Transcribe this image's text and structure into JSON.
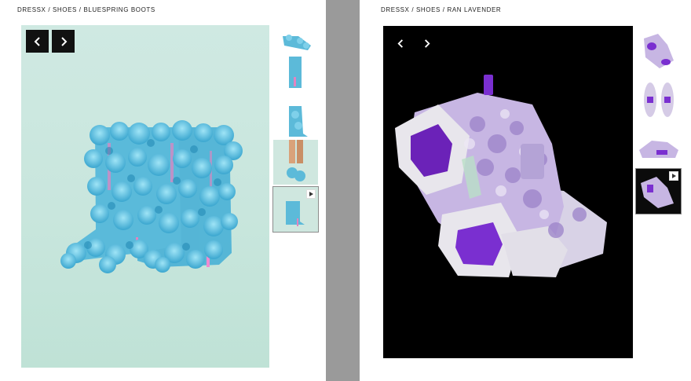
{
  "left_pane": {
    "breadcrumb": "DRESSX / SHOES / BLUESPRING BOOTS",
    "prev_icon": "chevron-left-icon",
    "next_icon": "chevron-right-icon",
    "thumbnail_count": 5,
    "selected_thumbnail": 5,
    "colors": {
      "background": "#cfe9e2",
      "flowers": "#5ab9d9",
      "accent": "#e07ab0"
    }
  },
  "right_pane": {
    "breadcrumb": "DRESSX / SHOES / RAN LAVENDER",
    "prev_icon": "chevron-left-icon",
    "next_icon": "chevron-right-icon",
    "thumbnail_count": 4,
    "selected_thumbnail": 4,
    "colors": {
      "background": "#000000",
      "shoe": "#c7b6e3",
      "accent": "#7a2fd0"
    }
  }
}
